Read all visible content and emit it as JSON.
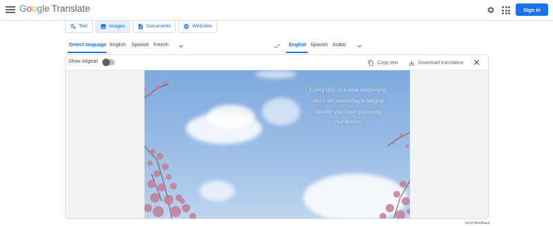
{
  "header": {
    "logo_letters": [
      "G",
      "o",
      "o",
      "g",
      "l",
      "e"
    ],
    "product": "Translate",
    "signin_label": "Sign in"
  },
  "modes": [
    {
      "label": "Text",
      "icon": "translate-icon",
      "active": false
    },
    {
      "label": "Images",
      "icon": "image-icon",
      "active": true
    },
    {
      "label": "Documents",
      "icon": "document-icon",
      "active": false
    },
    {
      "label": "Websites",
      "icon": "globe-icon",
      "active": false
    }
  ],
  "source_langs": {
    "detect": "Detect language",
    "items": [
      "English",
      "Spanish",
      "French"
    ]
  },
  "target_langs": {
    "items": [
      "English",
      "Spanish",
      "Arabic"
    ],
    "active": "English"
  },
  "toolbar": {
    "show_original": "Show original",
    "copy_text": "Copy text",
    "download": "Download translation"
  },
  "image": {
    "lines": [
      "Every day is a new beginning,",
      "don't let yesterday's fatigue",
      "hinder you from pursuing",
      "your dreams."
    ]
  },
  "footer": {
    "feedback": "Send feedback"
  },
  "colors": {
    "accent": "#1a73e8",
    "active_tab_bg": "#e8f0fe"
  }
}
